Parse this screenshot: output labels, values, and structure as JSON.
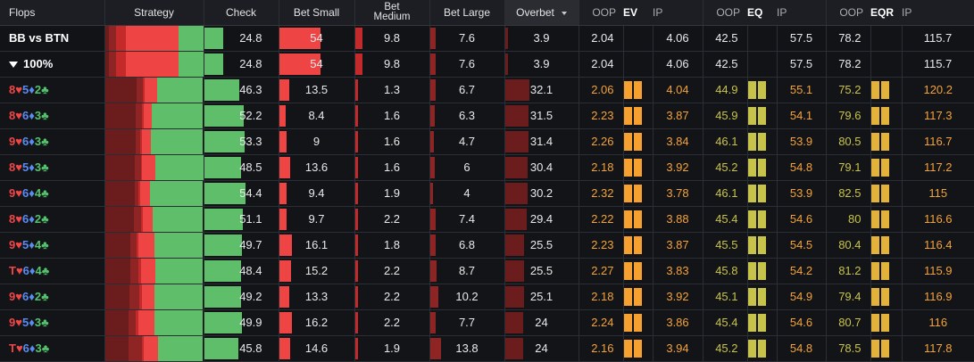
{
  "headers": {
    "flops": "Flops",
    "strategy": "Strategy",
    "check": "Check",
    "bet_small": "Bet Small",
    "bet_medium_1": "Bet",
    "bet_medium_2": "Medium",
    "bet_large": "Bet Large",
    "overbet": "Overbet",
    "ev_oop": "OOP",
    "ev_label": "EV",
    "ev_ip": "IP",
    "eq_oop": "OOP",
    "eq_label": "EQ",
    "eq_ip": "IP",
    "eqr_oop": "OOP",
    "eqr_label": "EQR",
    "eqr_ip": "IP"
  },
  "summary": [
    {
      "label": "BB vs BTN",
      "check": 24.8,
      "bet_small": 54,
      "bet_medium": 9.8,
      "bet_large": 7.6,
      "overbet": 3.9,
      "ev_oop": 2.04,
      "ev_ip": 4.06,
      "eq_oop": 42.5,
      "eq_ip": 57.5,
      "eqr_oop": 78.2,
      "eqr_ip": 115.7
    },
    {
      "label": "100%",
      "check": 24.8,
      "bet_small": 54,
      "bet_medium": 9.8,
      "bet_large": 7.6,
      "overbet": 3.9,
      "ev_oop": 2.04,
      "ev_ip": 4.06,
      "eq_oop": 42.5,
      "eq_ip": 57.5,
      "eqr_oop": 78.2,
      "eqr_ip": 115.7
    }
  ],
  "rows": [
    {
      "cards": [
        [
          "8",
          "♥",
          "r"
        ],
        [
          "5",
          "♦",
          "b"
        ],
        [
          "2",
          "♣",
          "g"
        ]
      ],
      "check": 46.3,
      "bet_small": 13.5,
      "bet_medium": 1.3,
      "bet_large": 6.7,
      "overbet": 32.1,
      "ev_oop": 2.06,
      "ev_ip": 4.04,
      "eq_oop": 44.9,
      "eq_ip": 55.1,
      "eqr_oop": 75.2,
      "eqr_ip": 120.2
    },
    {
      "cards": [
        [
          "8",
          "♥",
          "r"
        ],
        [
          "6",
          "♦",
          "b"
        ],
        [
          "3",
          "♣",
          "g"
        ]
      ],
      "check": 52.2,
      "bet_small": 8.4,
      "bet_medium": 1.6,
      "bet_large": 6.3,
      "overbet": 31.5,
      "ev_oop": 2.23,
      "ev_ip": 3.87,
      "eq_oop": 45.9,
      "eq_ip": 54.1,
      "eqr_oop": 79.6,
      "eqr_ip": 117.3
    },
    {
      "cards": [
        [
          "9",
          "♥",
          "r"
        ],
        [
          "6",
          "♦",
          "b"
        ],
        [
          "3",
          "♣",
          "g"
        ]
      ],
      "check": 53.3,
      "bet_small": 9,
      "bet_medium": 1.6,
      "bet_large": 4.7,
      "overbet": 31.4,
      "ev_oop": 2.26,
      "ev_ip": 3.84,
      "eq_oop": 46.1,
      "eq_ip": 53.9,
      "eqr_oop": 80.5,
      "eqr_ip": 116.7
    },
    {
      "cards": [
        [
          "8",
          "♥",
          "r"
        ],
        [
          "5",
          "♦",
          "b"
        ],
        [
          "3",
          "♣",
          "g"
        ]
      ],
      "check": 48.5,
      "bet_small": 13.6,
      "bet_medium": 1.6,
      "bet_large": 6,
      "overbet": 30.4,
      "ev_oop": 2.18,
      "ev_ip": 3.92,
      "eq_oop": 45.2,
      "eq_ip": 54.8,
      "eqr_oop": 79.1,
      "eqr_ip": 117.2
    },
    {
      "cards": [
        [
          "9",
          "♥",
          "r"
        ],
        [
          "6",
          "♦",
          "b"
        ],
        [
          "4",
          "♣",
          "g"
        ]
      ],
      "check": 54.4,
      "bet_small": 9.4,
      "bet_medium": 1.9,
      "bet_large": 4,
      "overbet": 30.2,
      "ev_oop": 2.32,
      "ev_ip": 3.78,
      "eq_oop": 46.1,
      "eq_ip": 53.9,
      "eqr_oop": 82.5,
      "eqr_ip": 115
    },
    {
      "cards": [
        [
          "8",
          "♥",
          "r"
        ],
        [
          "6",
          "♦",
          "b"
        ],
        [
          "2",
          "♣",
          "g"
        ]
      ],
      "check": 51.1,
      "bet_small": 9.7,
      "bet_medium": 2.2,
      "bet_large": 7.4,
      "overbet": 29.4,
      "ev_oop": 2.22,
      "ev_ip": 3.88,
      "eq_oop": 45.4,
      "eq_ip": 54.6,
      "eqr_oop": 80,
      "eqr_ip": 116.6
    },
    {
      "cards": [
        [
          "9",
          "♥",
          "r"
        ],
        [
          "5",
          "♦",
          "b"
        ],
        [
          "4",
          "♣",
          "g"
        ]
      ],
      "check": 49.7,
      "bet_small": 16.1,
      "bet_medium": 1.8,
      "bet_large": 6.8,
      "overbet": 25.5,
      "ev_oop": 2.23,
      "ev_ip": 3.87,
      "eq_oop": 45.5,
      "eq_ip": 54.5,
      "eqr_oop": 80.4,
      "eqr_ip": 116.4
    },
    {
      "cards": [
        [
          "T",
          "♥",
          "r"
        ],
        [
          "6",
          "♦",
          "b"
        ],
        [
          "4",
          "♣",
          "g"
        ]
      ],
      "check": 48.4,
      "bet_small": 15.2,
      "bet_medium": 2.2,
      "bet_large": 8.7,
      "overbet": 25.5,
      "ev_oop": 2.27,
      "ev_ip": 3.83,
      "eq_oop": 45.8,
      "eq_ip": 54.2,
      "eqr_oop": 81.2,
      "eqr_ip": 115.9
    },
    {
      "cards": [
        [
          "9",
          "♥",
          "r"
        ],
        [
          "6",
          "♦",
          "b"
        ],
        [
          "2",
          "♣",
          "g"
        ]
      ],
      "check": 49.2,
      "bet_small": 13.3,
      "bet_medium": 2.2,
      "bet_large": 10.2,
      "overbet": 25.1,
      "ev_oop": 2.18,
      "ev_ip": 3.92,
      "eq_oop": 45.1,
      "eq_ip": 54.9,
      "eqr_oop": 79.4,
      "eqr_ip": 116.9
    },
    {
      "cards": [
        [
          "9",
          "♥",
          "r"
        ],
        [
          "5",
          "♦",
          "b"
        ],
        [
          "3",
          "♣",
          "g"
        ]
      ],
      "check": 49.9,
      "bet_small": 16.2,
      "bet_medium": 2.2,
      "bet_large": 7.7,
      "overbet": 24,
      "ev_oop": 2.24,
      "ev_ip": 3.86,
      "eq_oop": 45.4,
      "eq_ip": 54.6,
      "eqr_oop": 80.7,
      "eqr_ip": 116
    },
    {
      "cards": [
        [
          "T",
          "♥",
          "r"
        ],
        [
          "6",
          "♦",
          "b"
        ],
        [
          "3",
          "♣",
          "g"
        ]
      ],
      "check": 45.8,
      "bet_small": 14.6,
      "bet_medium": 1.9,
      "bet_large": 13.8,
      "overbet": 24,
      "ev_oop": 2.16,
      "ev_ip": 3.94,
      "eq_oop": 45.2,
      "eq_ip": 54.8,
      "eqr_oop": 78.5,
      "eqr_ip": 117.8
    }
  ],
  "colors": {
    "check": "#5fbe6a",
    "bet_small": "#ef4444",
    "bet_medium": "#c42a2a",
    "bet_large": "#8f2424",
    "overbet": "#6b1c1c",
    "ev_sq": "#f5a02f",
    "eq_sq": "#c6c24a",
    "eqr_sq": "#e3b23a"
  }
}
